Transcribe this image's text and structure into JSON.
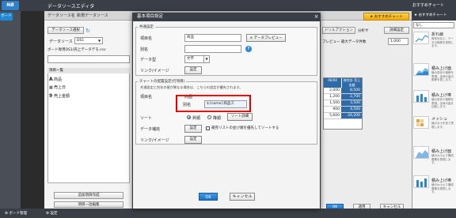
{
  "app": {
    "title": "データソースエディタ",
    "logo_text": "NB Cloud",
    "side_tab": "ボード",
    "right_panel_title": "おすすめチャート"
  },
  "editor": {
    "tabs": [
      "データソース名",
      "新規データソース"
    ],
    "source_select_button": "データソース選択",
    "source_label": "データソース",
    "source_value": "DS1",
    "source_path": "ボード専用DS1/売上データデモ.csv",
    "tree_header": "項目一覧",
    "tree_items": [
      {
        "icon": "A",
        "label": "商品"
      },
      {
        "icon": "▦",
        "label": "売上日"
      },
      {
        "icon": "9",
        "label": "売上金額"
      }
    ],
    "add_item_button": "追加項目作成",
    "bulk_edit_button": "項目一括編集",
    "toolbar_items": [
      "ドリルアクション",
      "分析サ",
      "詳細設定"
    ],
    "preview_label": "プレビュー 最大データ件数",
    "preview_count": "1,000",
    "recommend_button": "おすすめチャート",
    "table": {
      "headers": [
        "06/04",
        "総合計 売上金額"
      ],
      "rows": [
        [
          "2,000",
          "8,500"
        ],
        [
          "1,200",
          "2,700"
        ],
        [
          "1,500",
          "3,500"
        ],
        [
          "900",
          "4,500"
        ],
        [
          "5,600",
          "26,200"
        ]
      ]
    },
    "apply_button": "適用",
    "cancel_button": "キャンセル",
    "ok_button": "OK"
  },
  "dialog": {
    "title": "基本項目設定",
    "common_group_title": "共通設定",
    "item_name_label": "項目名",
    "item_name_value": "商品",
    "data_preview_button": "データプレビュー",
    "alias_label": "別名",
    "alias_value": "",
    "data_type_label": "データ型",
    "data_type_value": "文字",
    "link_image_label": "リンク/イメージ",
    "settings_button": "設定",
    "chart_group_title": "チャートの配置設定(行項目)",
    "chart_group_desc": "共通設定と別名の値が異なる場合は、こちらの設定が優先されます。",
    "chart_item_label": "項目名",
    "chart_item_value": "商品",
    "chart_alias_label": "別名",
    "chart_alias_value": "${name}商品ス",
    "sort_label": "ソート",
    "sort_asc": "昇順",
    "sort_desc": "降順",
    "sort_detail_button": "ソート詳細",
    "data_complement_label": "データ補完",
    "data_complement_button": "設定",
    "complement_checkbox_label": "補完リストの並び順を優先してソートする",
    "chart_link_label": "リンク/イメージ",
    "chart_link_button": "設定",
    "ok_button": "OK",
    "cancel_button": "キャンセル"
  },
  "right_panel": {
    "search_placeholder": "なし",
    "cards": [
      {
        "title": "折れ線",
        "desc": "時系列など、データの推移を表現します。"
      },
      {
        "title": "積み上げ面",
        "desc": "値の変化や推移を表現。全体の量の推移を表します。"
      },
      {
        "title": "積み上げ棒",
        "desc": "値の変化や推移を表現。全体の量を比較します。"
      },
      {
        "title": "メッシュ",
        "desc": "値の大小を色で表現します。"
      },
      {
        "title": "積み上げ面",
        "desc": "値の大小より構成要素を表現します。"
      },
      {
        "title": "積み上げ棒",
        "desc": "値の大小より構成要素を表現します。"
      }
    ]
  },
  "status": {
    "board_management": "ボード管理",
    "settings_label": "設定"
  }
}
